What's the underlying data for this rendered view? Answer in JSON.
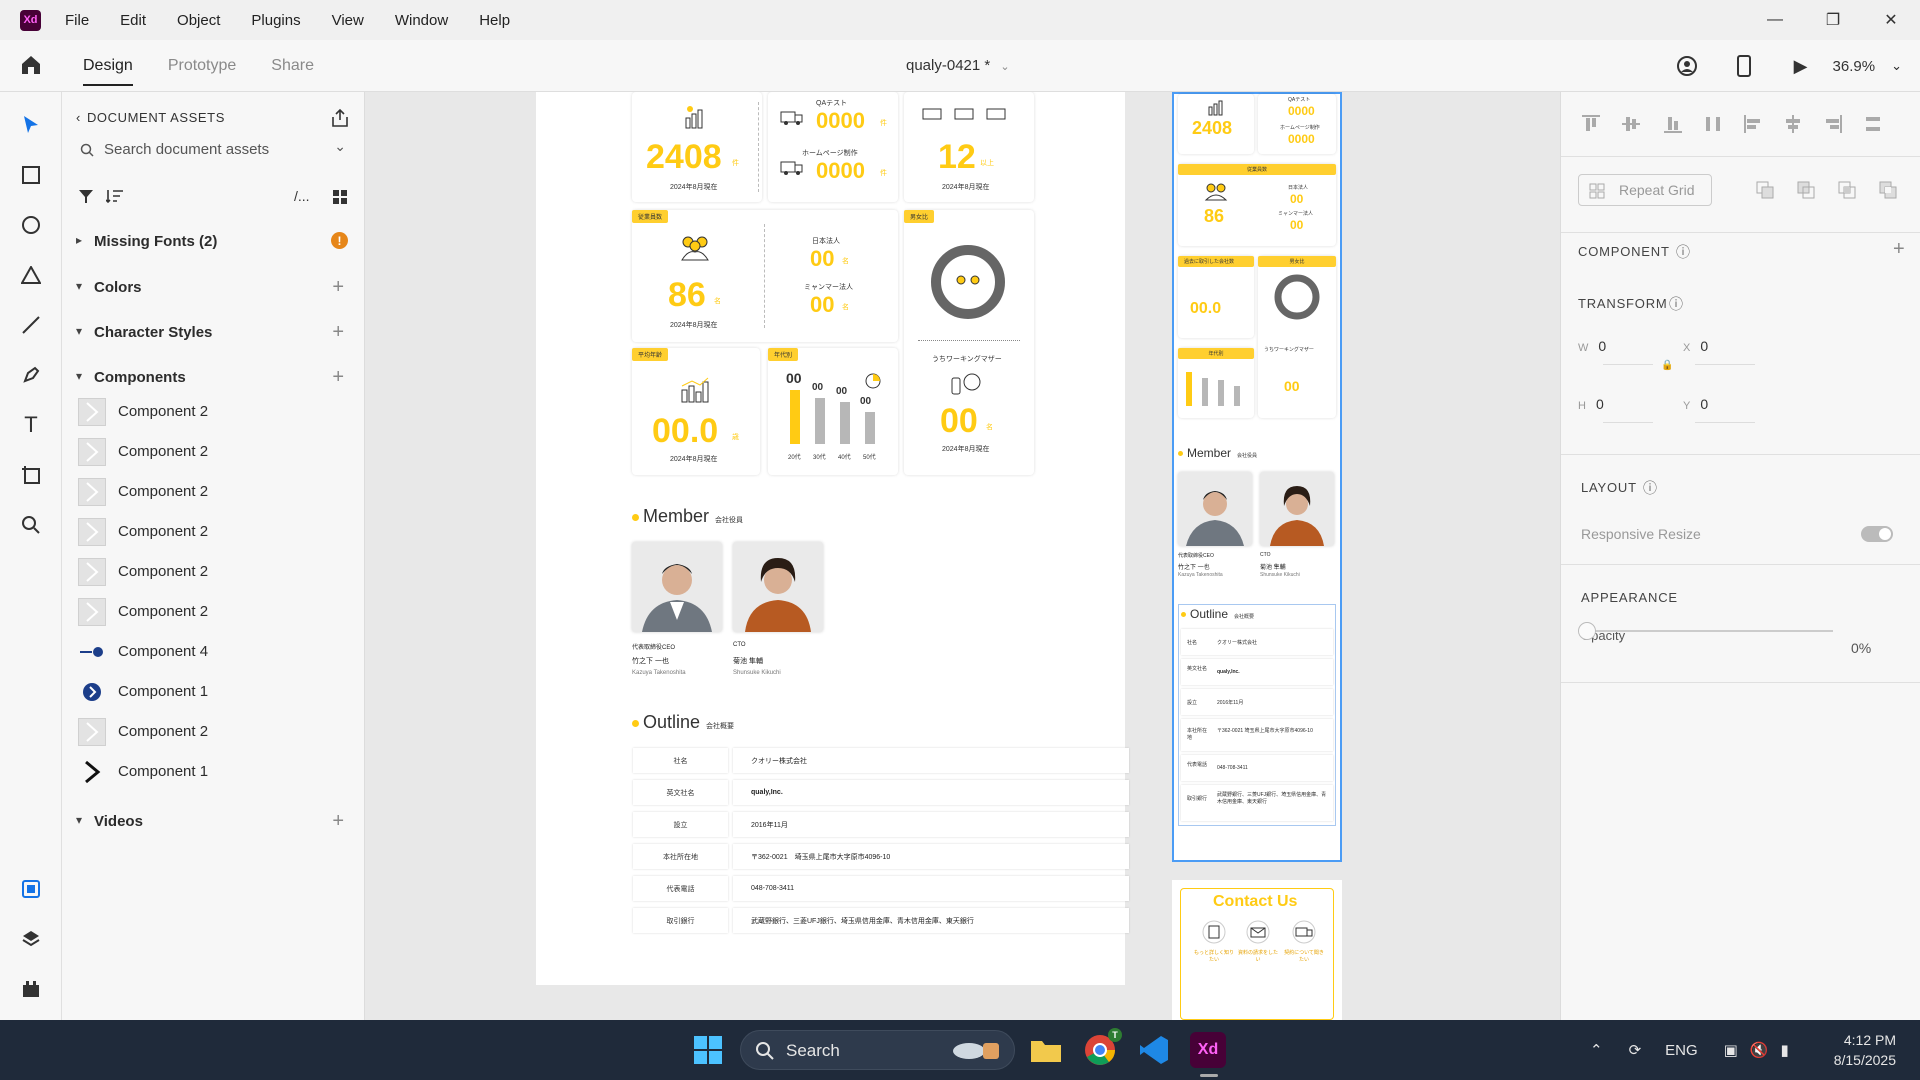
{
  "app": {
    "logo": "Xd"
  },
  "menu": [
    "File",
    "Edit",
    "Object",
    "Plugins",
    "View",
    "Window",
    "Help"
  ],
  "tabs": [
    "Design",
    "Prototype",
    "Share"
  ],
  "doc_title": "qualy-0421 *",
  "zoom": "36.9%",
  "assets": {
    "header": "DOCUMENT ASSETS",
    "search_placeholder": "Search document assets",
    "filter_path": "/...",
    "missing_fonts": "Missing Fonts (2)",
    "warning_glyph": "!",
    "colors": "Colors",
    "character_styles": "Character Styles",
    "components": "Components",
    "videos": "Videos",
    "component_items": [
      "Component 2",
      "Component 2",
      "Component 2",
      "Component 2",
      "Component 2",
      "Component 2",
      "Component 4",
      "Component 1",
      "Component 2",
      "Component 1"
    ]
  },
  "artboard": {
    "qa_test": "QAテスト",
    "homepage": "ホームページ制作",
    "n2408": "2408",
    "ken": "件",
    "n0000": "0000",
    "n12": "12",
    "ijo": "以上",
    "as_of": "2024年8月現在",
    "employees_tag": "従業員数",
    "n86": "86",
    "mei": "名",
    "japan_corp": "日本法人",
    "myanmar_corp": "ミャンマー法人",
    "n00": "00",
    "gender_tag": "男女比",
    "working_mother": "うちワーキングマザー",
    "avg_age_tag": "平均年齢",
    "n00_0": "00.0",
    "sai": "歳",
    "age_tag": "年代別",
    "age_labels": [
      "20代",
      "30代",
      "40代",
      "50代"
    ],
    "member_title": "Member",
    "member_sub": "会社役員",
    "members": [
      {
        "role": "代表取締役CEO",
        "name": "竹之下 一也",
        "roman": "Kazuya Takenoshita"
      },
      {
        "role": "CTO",
        "name": "菊池 隼輔",
        "roman": "Shunsuke Kikuchi"
      }
    ],
    "outline_title": "Outline",
    "outline_sub": "会社概要",
    "outline": [
      {
        "label": "社名",
        "value": "クオリー株式会社"
      },
      {
        "label": "英文社名",
        "value": "qualy,Inc."
      },
      {
        "label": "設立",
        "value": "2016年11月"
      },
      {
        "label": "本社所在地",
        "value": "〒362-0021　埼玉県上尾市大字原市4096-10"
      },
      {
        "label": "代表電話",
        "value": "048-708-3411"
      },
      {
        "label": "取引銀行",
        "value": "武蔵野銀行、三菱UFJ銀行、埼玉県信用金庫、青木信用金庫、東天銀行"
      }
    ]
  },
  "side": {
    "past_tag": "過去に取引した会社数",
    "outline": [
      {
        "label": "社名",
        "value": "クオリー株式会社"
      },
      {
        "label": "英文社名",
        "value": "qualy,Inc."
      },
      {
        "label": "設立",
        "value": "2016年11月"
      },
      {
        "label": "本社所在地",
        "value": "〒362-0021 埼玉県上尾市大字原市4096-10"
      },
      {
        "label": "代表電話",
        "value": "048-708-3411"
      },
      {
        "label": "取引銀行",
        "value": "武蔵野銀行、三菱UFJ銀行、埼玉県信用金庫、青木信用金庫、東天銀行"
      }
    ],
    "contact_title": "Contact Us",
    "contact_items": [
      "もっと詳しく知りたい",
      "資料の請求をしたい",
      "契約について聞きたい"
    ]
  },
  "props": {
    "repeat_grid": "Repeat Grid",
    "component": "COMPONENT",
    "transform": "TRANSFORM",
    "w_label": "W",
    "w_value": "0",
    "x_label": "X",
    "x_value": "0",
    "h_label": "H",
    "h_value": "0",
    "y_label": "Y",
    "y_value": "0",
    "layout": "LAYOUT",
    "responsive_resize": "Responsive Resize",
    "appearance": "APPEARANCE",
    "opacity_label": "Opacity",
    "opacity_value": "0%"
  },
  "taskbar": {
    "search": "Search",
    "lang": "ENG",
    "time": "4:12 PM",
    "date": "8/15/2025",
    "xd": "Xd",
    "chrome_badge": "T"
  },
  "colors": {
    "accent_yellow": "#ffcb14",
    "selection_blue": "#4b9cf5",
    "xd_purple": "#470137"
  }
}
